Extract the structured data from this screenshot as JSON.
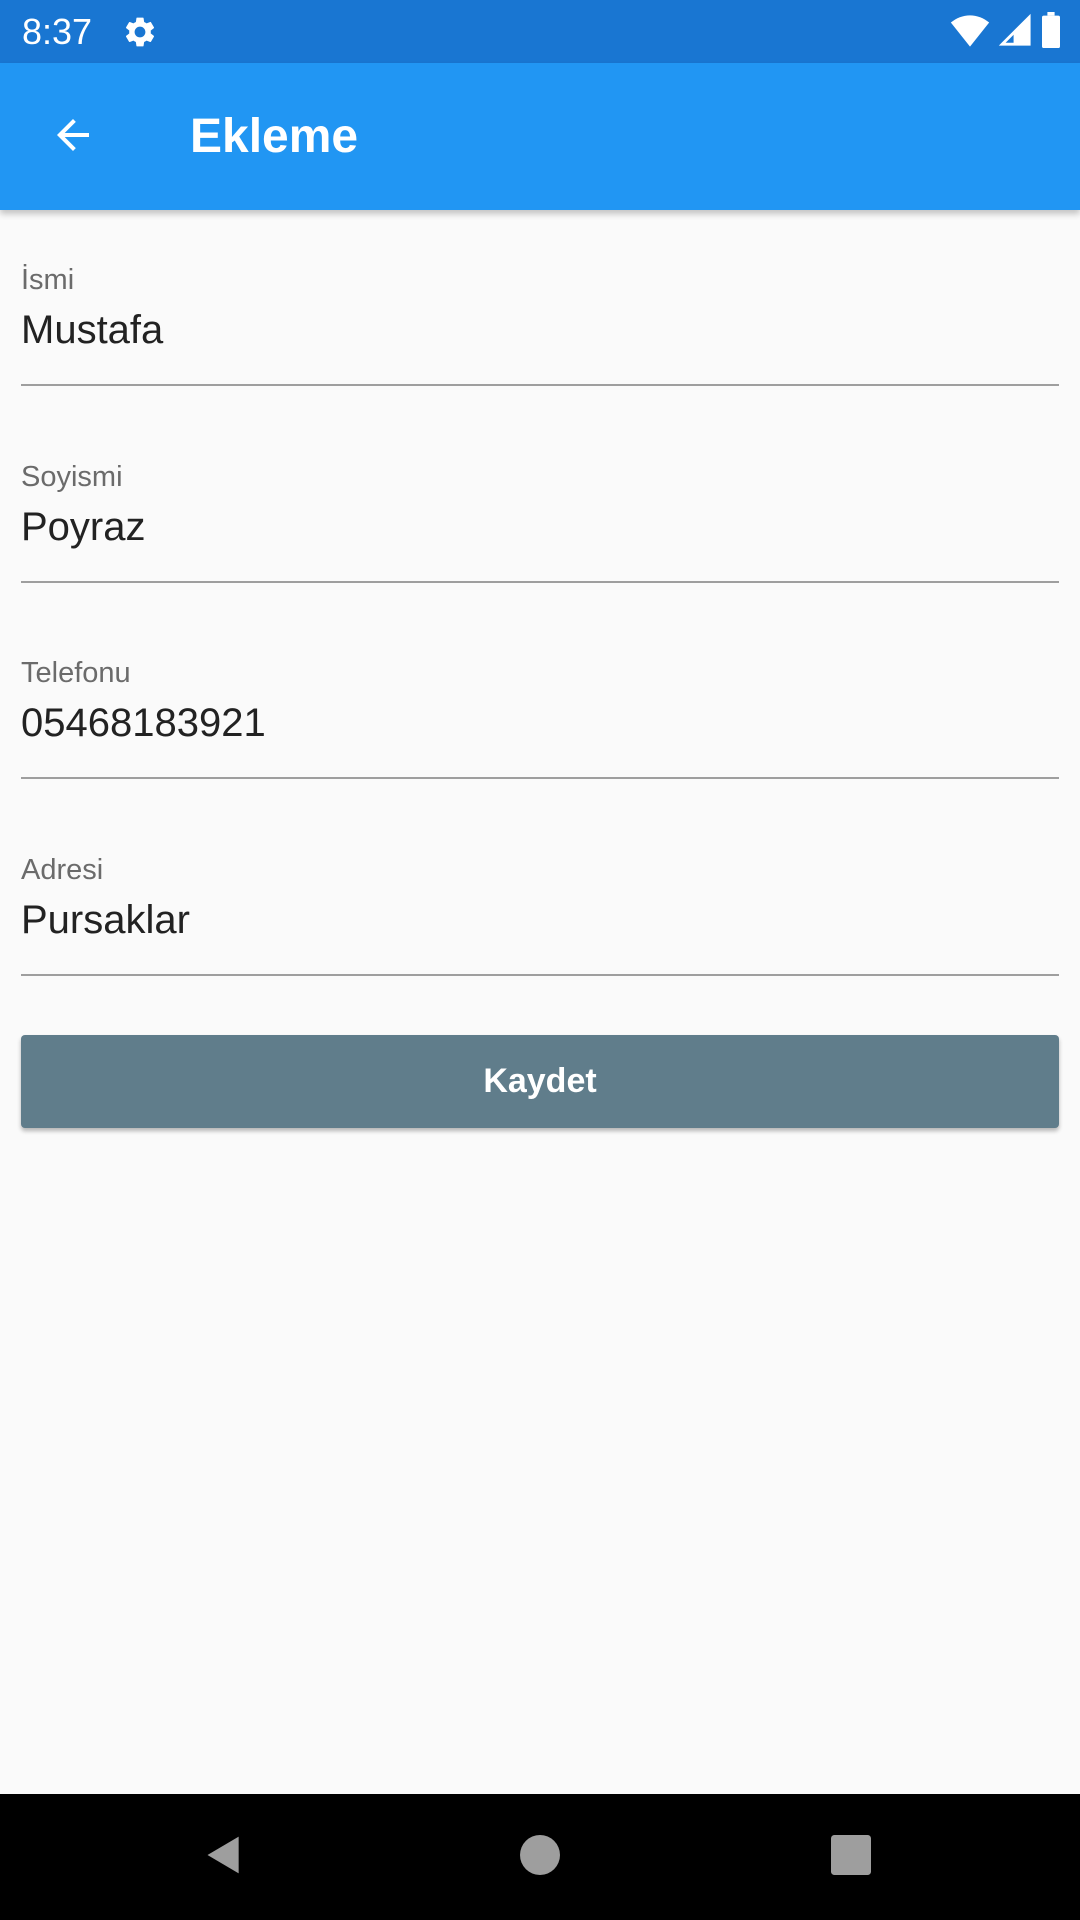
{
  "status_bar": {
    "time": "8:37",
    "icons": [
      "gear-icon",
      "wifi-icon",
      "signal-icon",
      "battery-icon"
    ],
    "background": "#1976d2"
  },
  "app_bar": {
    "title": "Ekleme",
    "back_icon": "arrow-back-icon",
    "background": "#2196f3"
  },
  "form": {
    "fields": [
      {
        "label": "İsmi",
        "value": "Mustafa"
      },
      {
        "label": "Soyismi",
        "value": "Poyraz"
      },
      {
        "label": "Telefonu",
        "value": "05468183921"
      },
      {
        "label": "Adresi",
        "value": "Pursaklar"
      }
    ],
    "save_label": "Kaydet",
    "save_color": "#607d8b"
  },
  "nav_bar": {
    "icons": [
      "back-triangle-icon",
      "home-circle-icon",
      "recents-square-icon"
    ]
  }
}
